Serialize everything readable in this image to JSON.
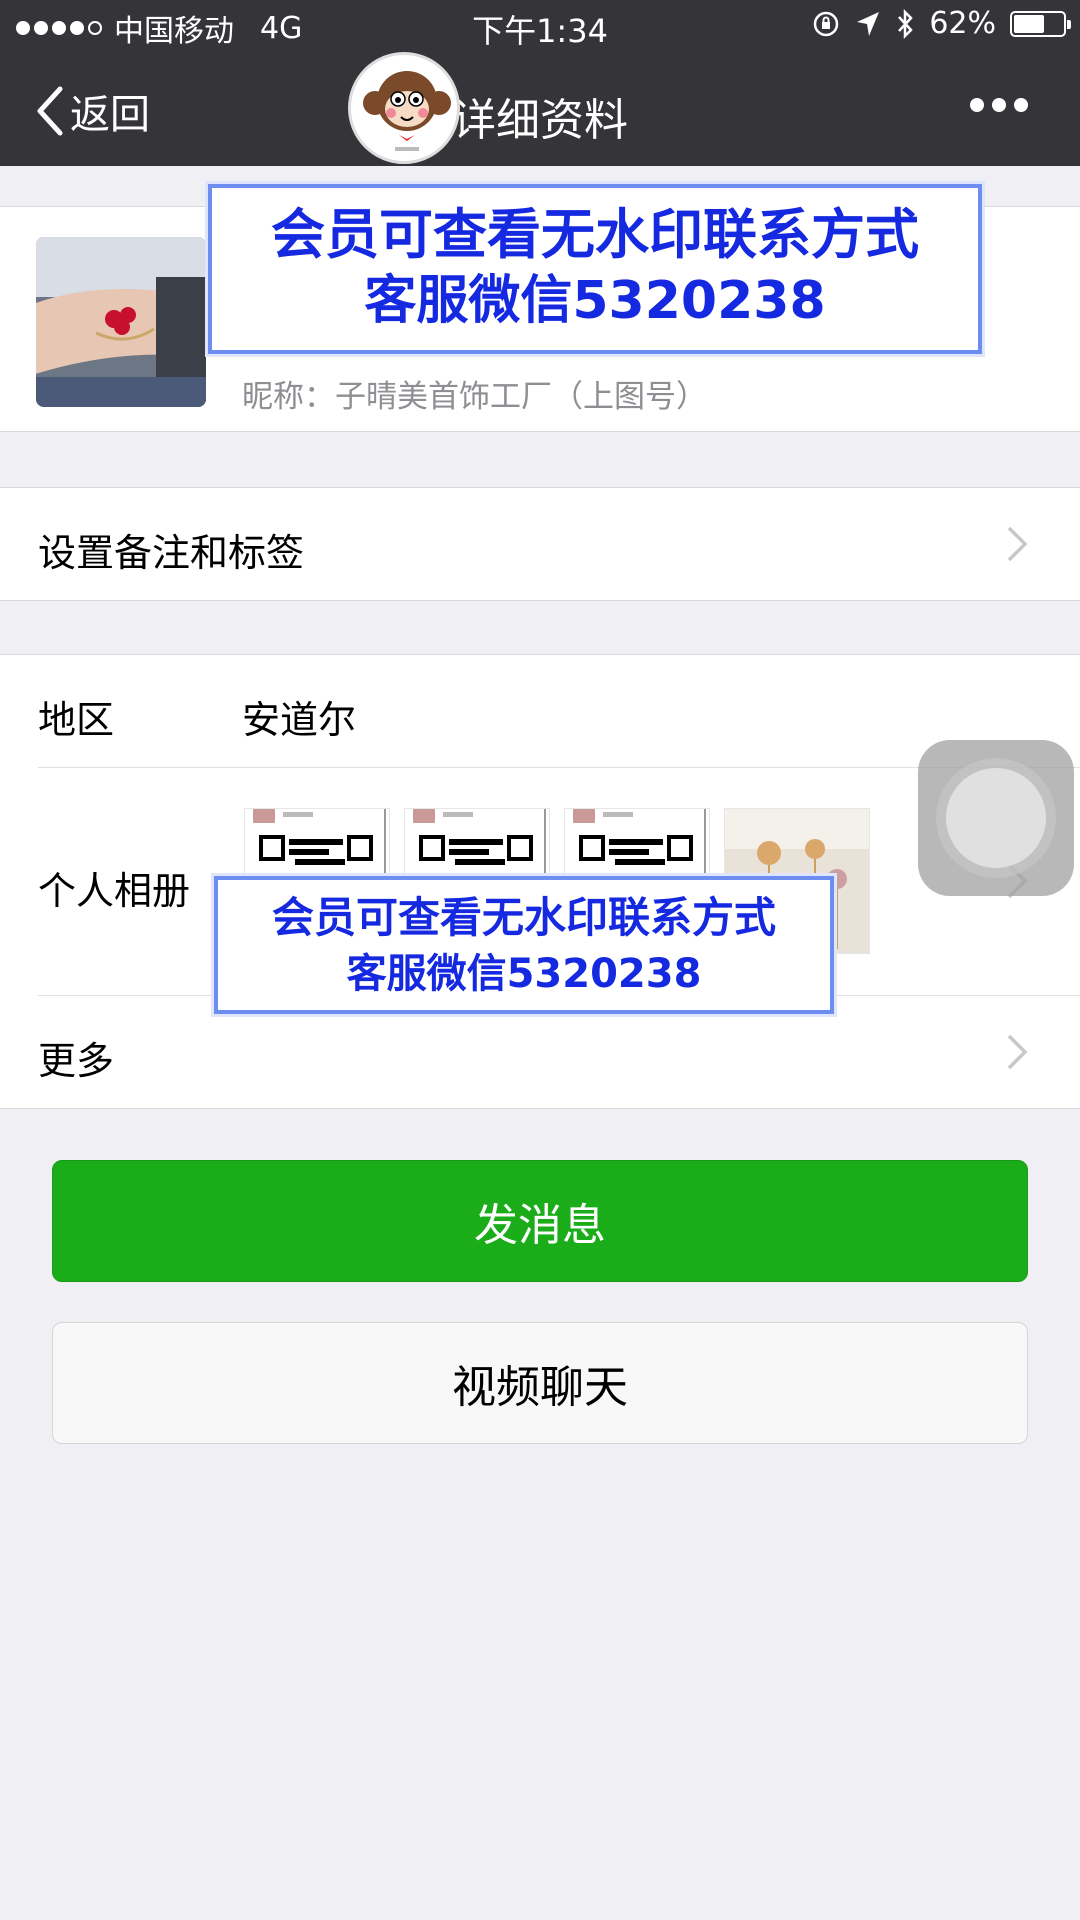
{
  "status_bar": {
    "carrier": "中国移动",
    "network": "4G",
    "time": "下午1:34",
    "battery": "62%",
    "battery_level": 0.62
  },
  "nav": {
    "back_label": "返回",
    "title": "详细资料",
    "more_icon": "more-dots-icon"
  },
  "profile": {
    "nickname": "昵称：子晴美首饰工厂（上图号）"
  },
  "remark_row": {
    "label": "设置备注和标签"
  },
  "region_row": {
    "label": "地区",
    "value": "安道尔"
  },
  "album_row": {
    "label": "个人相册"
  },
  "more_row": {
    "label": "更多"
  },
  "actions": {
    "send_message": "发消息",
    "video_chat": "视频聊天"
  },
  "watermark": {
    "line1": "会员可查看无水印联系方式",
    "line2": "客服微信5320238"
  },
  "colors": {
    "nav_bg": "#353539",
    "primary_green": "#1aad19",
    "watermark_text": "#1429e0",
    "page_bg": "#efeff4"
  }
}
